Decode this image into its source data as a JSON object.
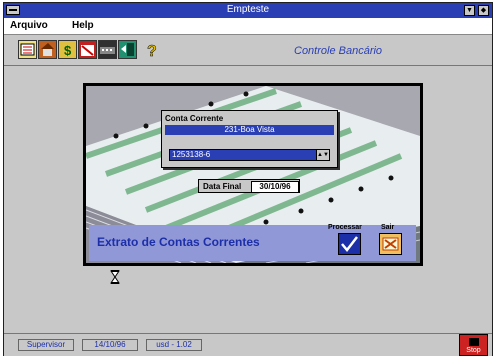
{
  "window": {
    "title": "Empteste"
  },
  "menu": {
    "items": [
      "Arquivo",
      "Help"
    ]
  },
  "toolbar": {
    "icons": [
      "records-icon",
      "building-icon",
      "money-icon",
      "calendar-icon",
      "keyboard-icon",
      "exit-door-icon",
      "help-question-icon"
    ],
    "title": "Controle Bancário"
  },
  "conta_corrente": {
    "label": "Conta Corrente",
    "account": "231-Boa Vista",
    "selected_number": "1253138-6"
  },
  "date": {
    "label": "Data Final",
    "value": "30/10/96"
  },
  "panel": {
    "title": "Extrato de Contas Correntes",
    "process_label": "Processar",
    "exit_label": "Sair"
  },
  "status": {
    "user": "Supervisor",
    "date": "14/10/96",
    "version": "usd - 1.02"
  },
  "stop": {
    "label": "Stop"
  },
  "colors": {
    "title_bar": "#2a3fb3",
    "accent_text": "#1c2fa8",
    "panel": "#9098d8",
    "stop_button": "#cc2222"
  }
}
